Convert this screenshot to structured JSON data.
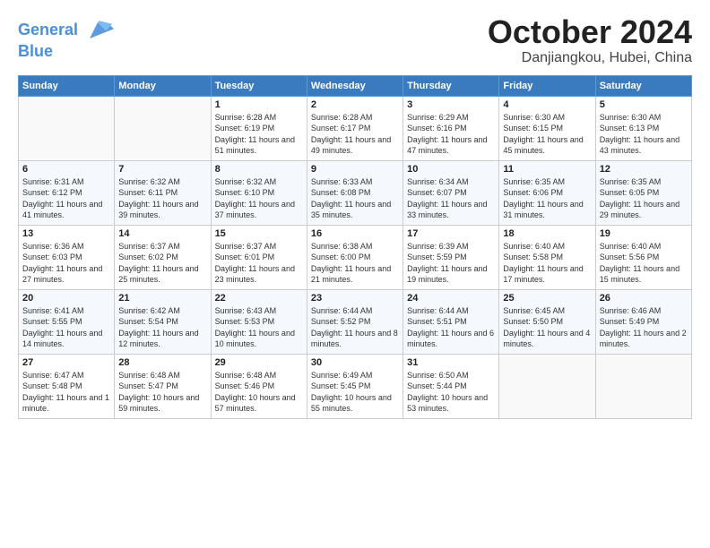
{
  "header": {
    "logo_line1": "General",
    "logo_line2": "Blue",
    "month_title": "October 2024",
    "subtitle": "Danjiangkou, Hubei, China"
  },
  "weekdays": [
    "Sunday",
    "Monday",
    "Tuesday",
    "Wednesday",
    "Thursday",
    "Friday",
    "Saturday"
  ],
  "weeks": [
    [
      {
        "day": "",
        "sunrise": "",
        "sunset": "",
        "daylight": ""
      },
      {
        "day": "",
        "sunrise": "",
        "sunset": "",
        "daylight": ""
      },
      {
        "day": "1",
        "sunrise": "Sunrise: 6:28 AM",
        "sunset": "Sunset: 6:19 PM",
        "daylight": "Daylight: 11 hours and 51 minutes."
      },
      {
        "day": "2",
        "sunrise": "Sunrise: 6:28 AM",
        "sunset": "Sunset: 6:17 PM",
        "daylight": "Daylight: 11 hours and 49 minutes."
      },
      {
        "day": "3",
        "sunrise": "Sunrise: 6:29 AM",
        "sunset": "Sunset: 6:16 PM",
        "daylight": "Daylight: 11 hours and 47 minutes."
      },
      {
        "day": "4",
        "sunrise": "Sunrise: 6:30 AM",
        "sunset": "Sunset: 6:15 PM",
        "daylight": "Daylight: 11 hours and 45 minutes."
      },
      {
        "day": "5",
        "sunrise": "Sunrise: 6:30 AM",
        "sunset": "Sunset: 6:13 PM",
        "daylight": "Daylight: 11 hours and 43 minutes."
      }
    ],
    [
      {
        "day": "6",
        "sunrise": "Sunrise: 6:31 AM",
        "sunset": "Sunset: 6:12 PM",
        "daylight": "Daylight: 11 hours and 41 minutes."
      },
      {
        "day": "7",
        "sunrise": "Sunrise: 6:32 AM",
        "sunset": "Sunset: 6:11 PM",
        "daylight": "Daylight: 11 hours and 39 minutes."
      },
      {
        "day": "8",
        "sunrise": "Sunrise: 6:32 AM",
        "sunset": "Sunset: 6:10 PM",
        "daylight": "Daylight: 11 hours and 37 minutes."
      },
      {
        "day": "9",
        "sunrise": "Sunrise: 6:33 AM",
        "sunset": "Sunset: 6:08 PM",
        "daylight": "Daylight: 11 hours and 35 minutes."
      },
      {
        "day": "10",
        "sunrise": "Sunrise: 6:34 AM",
        "sunset": "Sunset: 6:07 PM",
        "daylight": "Daylight: 11 hours and 33 minutes."
      },
      {
        "day": "11",
        "sunrise": "Sunrise: 6:35 AM",
        "sunset": "Sunset: 6:06 PM",
        "daylight": "Daylight: 11 hours and 31 minutes."
      },
      {
        "day": "12",
        "sunrise": "Sunrise: 6:35 AM",
        "sunset": "Sunset: 6:05 PM",
        "daylight": "Daylight: 11 hours and 29 minutes."
      }
    ],
    [
      {
        "day": "13",
        "sunrise": "Sunrise: 6:36 AM",
        "sunset": "Sunset: 6:03 PM",
        "daylight": "Daylight: 11 hours and 27 minutes."
      },
      {
        "day": "14",
        "sunrise": "Sunrise: 6:37 AM",
        "sunset": "Sunset: 6:02 PM",
        "daylight": "Daylight: 11 hours and 25 minutes."
      },
      {
        "day": "15",
        "sunrise": "Sunrise: 6:37 AM",
        "sunset": "Sunset: 6:01 PM",
        "daylight": "Daylight: 11 hours and 23 minutes."
      },
      {
        "day": "16",
        "sunrise": "Sunrise: 6:38 AM",
        "sunset": "Sunset: 6:00 PM",
        "daylight": "Daylight: 11 hours and 21 minutes."
      },
      {
        "day": "17",
        "sunrise": "Sunrise: 6:39 AM",
        "sunset": "Sunset: 5:59 PM",
        "daylight": "Daylight: 11 hours and 19 minutes."
      },
      {
        "day": "18",
        "sunrise": "Sunrise: 6:40 AM",
        "sunset": "Sunset: 5:58 PM",
        "daylight": "Daylight: 11 hours and 17 minutes."
      },
      {
        "day": "19",
        "sunrise": "Sunrise: 6:40 AM",
        "sunset": "Sunset: 5:56 PM",
        "daylight": "Daylight: 11 hours and 15 minutes."
      }
    ],
    [
      {
        "day": "20",
        "sunrise": "Sunrise: 6:41 AM",
        "sunset": "Sunset: 5:55 PM",
        "daylight": "Daylight: 11 hours and 14 minutes."
      },
      {
        "day": "21",
        "sunrise": "Sunrise: 6:42 AM",
        "sunset": "Sunset: 5:54 PM",
        "daylight": "Daylight: 11 hours and 12 minutes."
      },
      {
        "day": "22",
        "sunrise": "Sunrise: 6:43 AM",
        "sunset": "Sunset: 5:53 PM",
        "daylight": "Daylight: 11 hours and 10 minutes."
      },
      {
        "day": "23",
        "sunrise": "Sunrise: 6:44 AM",
        "sunset": "Sunset: 5:52 PM",
        "daylight": "Daylight: 11 hours and 8 minutes."
      },
      {
        "day": "24",
        "sunrise": "Sunrise: 6:44 AM",
        "sunset": "Sunset: 5:51 PM",
        "daylight": "Daylight: 11 hours and 6 minutes."
      },
      {
        "day": "25",
        "sunrise": "Sunrise: 6:45 AM",
        "sunset": "Sunset: 5:50 PM",
        "daylight": "Daylight: 11 hours and 4 minutes."
      },
      {
        "day": "26",
        "sunrise": "Sunrise: 6:46 AM",
        "sunset": "Sunset: 5:49 PM",
        "daylight": "Daylight: 11 hours and 2 minutes."
      }
    ],
    [
      {
        "day": "27",
        "sunrise": "Sunrise: 6:47 AM",
        "sunset": "Sunset: 5:48 PM",
        "daylight": "Daylight: 11 hours and 1 minute."
      },
      {
        "day": "28",
        "sunrise": "Sunrise: 6:48 AM",
        "sunset": "Sunset: 5:47 PM",
        "daylight": "Daylight: 10 hours and 59 minutes."
      },
      {
        "day": "29",
        "sunrise": "Sunrise: 6:48 AM",
        "sunset": "Sunset: 5:46 PM",
        "daylight": "Daylight: 10 hours and 57 minutes."
      },
      {
        "day": "30",
        "sunrise": "Sunrise: 6:49 AM",
        "sunset": "Sunset: 5:45 PM",
        "daylight": "Daylight: 10 hours and 55 minutes."
      },
      {
        "day": "31",
        "sunrise": "Sunrise: 6:50 AM",
        "sunset": "Sunset: 5:44 PM",
        "daylight": "Daylight: 10 hours and 53 minutes."
      },
      {
        "day": "",
        "sunrise": "",
        "sunset": "",
        "daylight": ""
      },
      {
        "day": "",
        "sunrise": "",
        "sunset": "",
        "daylight": ""
      }
    ]
  ]
}
